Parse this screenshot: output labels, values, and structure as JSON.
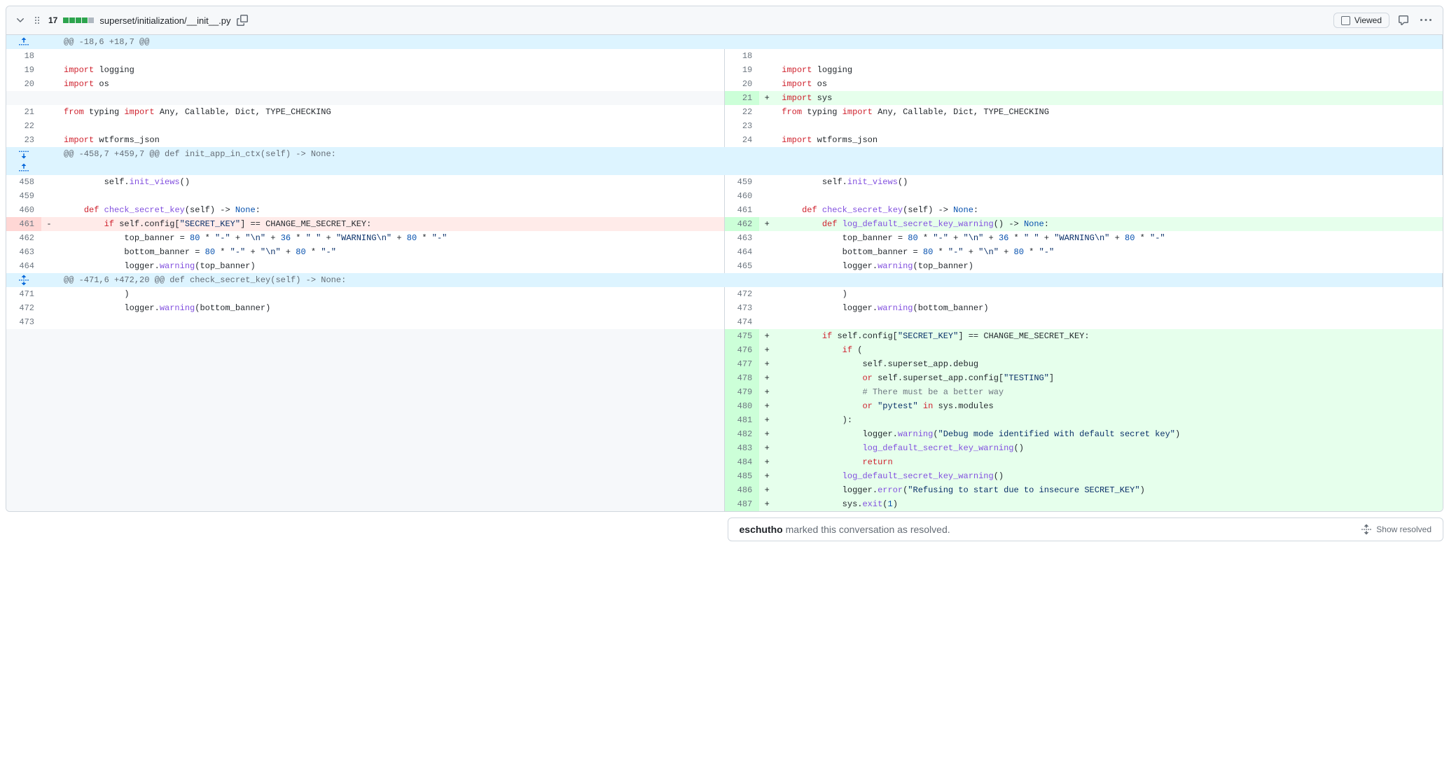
{
  "file": {
    "change_count": "17",
    "bars": {
      "add": 4,
      "neutral": 1
    },
    "path": "superset/initialization/__init__.py",
    "viewed_label": "Viewed"
  },
  "hunks": [
    {
      "text": "@@ -18,6 +18,7 @@",
      "expander": "up"
    },
    {
      "text": "@@ -458,7 +459,7 @@ def init_app_in_ctx(self) -> None:",
      "expander": "both"
    },
    {
      "text": "@@ -471,6 +472,20 @@ def check_secret_key(self) -> None:",
      "expander": "mid"
    }
  ],
  "lines_group_0": [
    {
      "l": "18",
      "r": "18",
      "lh": "",
      "rh": ""
    },
    {
      "l": "19",
      "r": "19",
      "lh": "<span class='k'>import</span> logging",
      "rh": "<span class='k'>import</span> logging"
    },
    {
      "l": "20",
      "r": "20",
      "lh": "<span class='k'>import</span> os",
      "rh": "<span class='k'>import</span> os"
    },
    {
      "type": "add",
      "r": "21",
      "rh": "<span class='k'>import</span> sys"
    },
    {
      "l": "21",
      "r": "22",
      "lh": "<span class='k'>from</span> typing <span class='k'>import</span> Any, Callable, Dict, TYPE_CHECKING",
      "rh": "<span class='k'>from</span> typing <span class='k'>import</span> Any, Callable, Dict, TYPE_CHECKING"
    },
    {
      "l": "22",
      "r": "23",
      "lh": "",
      "rh": ""
    },
    {
      "l": "23",
      "r": "24",
      "lh": "<span class='k'>import</span> wtforms_json",
      "rh": "<span class='k'>import</span> wtforms_json"
    }
  ],
  "lines_group_1": [
    {
      "l": "458",
      "r": "459",
      "lh": "        self.<span class='f'>init_views</span>()",
      "rh": "        self.<span class='f'>init_views</span>()"
    },
    {
      "l": "459",
      "r": "460",
      "lh": "",
      "rh": ""
    },
    {
      "l": "460",
      "r": "461",
      "lh": "    <span class='k'>def</span> <span class='f'>check_secret_key</span>(self) -&gt; <span class='v'>None</span>:",
      "rh": "    <span class='k'>def</span> <span class='f'>check_secret_key</span>(self) -&gt; <span class='v'>None</span>:"
    },
    {
      "type": "change",
      "l": "461",
      "r": "462",
      "lh": "        <span class='k'>if</span> self.config[<span class='s'>\"SECRET_KEY\"</span>] == CHANGE_ME_SECRET_KEY:",
      "rh": "        <span class='k'>def</span> <span class='f'>log_default_secret_key_warning</span>() -&gt; <span class='v'>None</span>:"
    },
    {
      "l": "462",
      "r": "463",
      "lh": "            top_banner = <span class='v'>80</span> * <span class='s'>\"-\"</span> + <span class='s'>\"\\n\"</span> + <span class='v'>36</span> * <span class='s'>\" \"</span> + <span class='s'>\"WARNING\\n\"</span> + <span class='v'>80</span> * <span class='s'>\"-\"</span>",
      "rh": "            top_banner = <span class='v'>80</span> * <span class='s'>\"-\"</span> + <span class='s'>\"\\n\"</span> + <span class='v'>36</span> * <span class='s'>\" \"</span> + <span class='s'>\"WARNING\\n\"</span> + <span class='v'>80</span> * <span class='s'>\"-\"</span>"
    },
    {
      "l": "463",
      "r": "464",
      "lh": "            bottom_banner = <span class='v'>80</span> * <span class='s'>\"-\"</span> + <span class='s'>\"\\n\"</span> + <span class='v'>80</span> * <span class='s'>\"-\"</span>",
      "rh": "            bottom_banner = <span class='v'>80</span> * <span class='s'>\"-\"</span> + <span class='s'>\"\\n\"</span> + <span class='v'>80</span> * <span class='s'>\"-\"</span>"
    },
    {
      "l": "464",
      "r": "465",
      "lh": "            logger.<span class='f'>warning</span>(top_banner)",
      "rh": "            logger.<span class='f'>warning</span>(top_banner)"
    }
  ],
  "lines_group_2": [
    {
      "l": "471",
      "r": "472",
      "lh": "            )",
      "rh": "            )"
    },
    {
      "l": "472",
      "r": "473",
      "lh": "            logger.<span class='f'>warning</span>(bottom_banner)",
      "rh": "            logger.<span class='f'>warning</span>(bottom_banner)"
    },
    {
      "l": "473",
      "r": "474",
      "lh": "",
      "rh": ""
    },
    {
      "type": "add",
      "r": "475",
      "rh": "        <span class='k'>if</span> self.config[<span class='s'>\"SECRET_KEY\"</span>] == CHANGE_ME_SECRET_KEY:"
    },
    {
      "type": "add",
      "r": "476",
      "rh": "            <span class='k'>if</span> ("
    },
    {
      "type": "add",
      "r": "477",
      "rh": "                self.superset_app.debug"
    },
    {
      "type": "add",
      "r": "478",
      "rh": "                <span class='k'>or</span> self.superset_app.config[<span class='s'>\"TESTING\"</span>]"
    },
    {
      "type": "add",
      "r": "479",
      "rh": "                <span class='c'># There must be a better way</span>"
    },
    {
      "type": "add",
      "r": "480",
      "rh": "                <span class='k'>or</span> <span class='s'>\"pytest\"</span> <span class='k'>in</span> sys.modules"
    },
    {
      "type": "add",
      "r": "481",
      "rh": "            ):"
    },
    {
      "type": "add",
      "r": "482",
      "rh": "                logger.<span class='f'>warning</span>(<span class='s'>\"Debug mode identified with default secret key\"</span>)"
    },
    {
      "type": "add",
      "r": "483",
      "rh": "                <span class='f'>log_default_secret_key_warning</span>()"
    },
    {
      "type": "add",
      "r": "484",
      "rh": "                <span class='k'>return</span>"
    },
    {
      "type": "add",
      "r": "485",
      "rh": "            <span class='f'>log_default_secret_key_warning</span>()"
    },
    {
      "type": "add",
      "r": "486",
      "rh": "            logger.<span class='f'>error</span>(<span class='s'>\"Refusing to start due to insecure SECRET_KEY\"</span>)"
    },
    {
      "type": "add",
      "r": "487",
      "rh": "            sys.<span class='f'>exit</span>(<span class='v'>1</span>)"
    }
  ],
  "resolved": {
    "user": "eschutho",
    "msg": " marked this conversation as resolved.",
    "show_label": "Show resolved"
  }
}
